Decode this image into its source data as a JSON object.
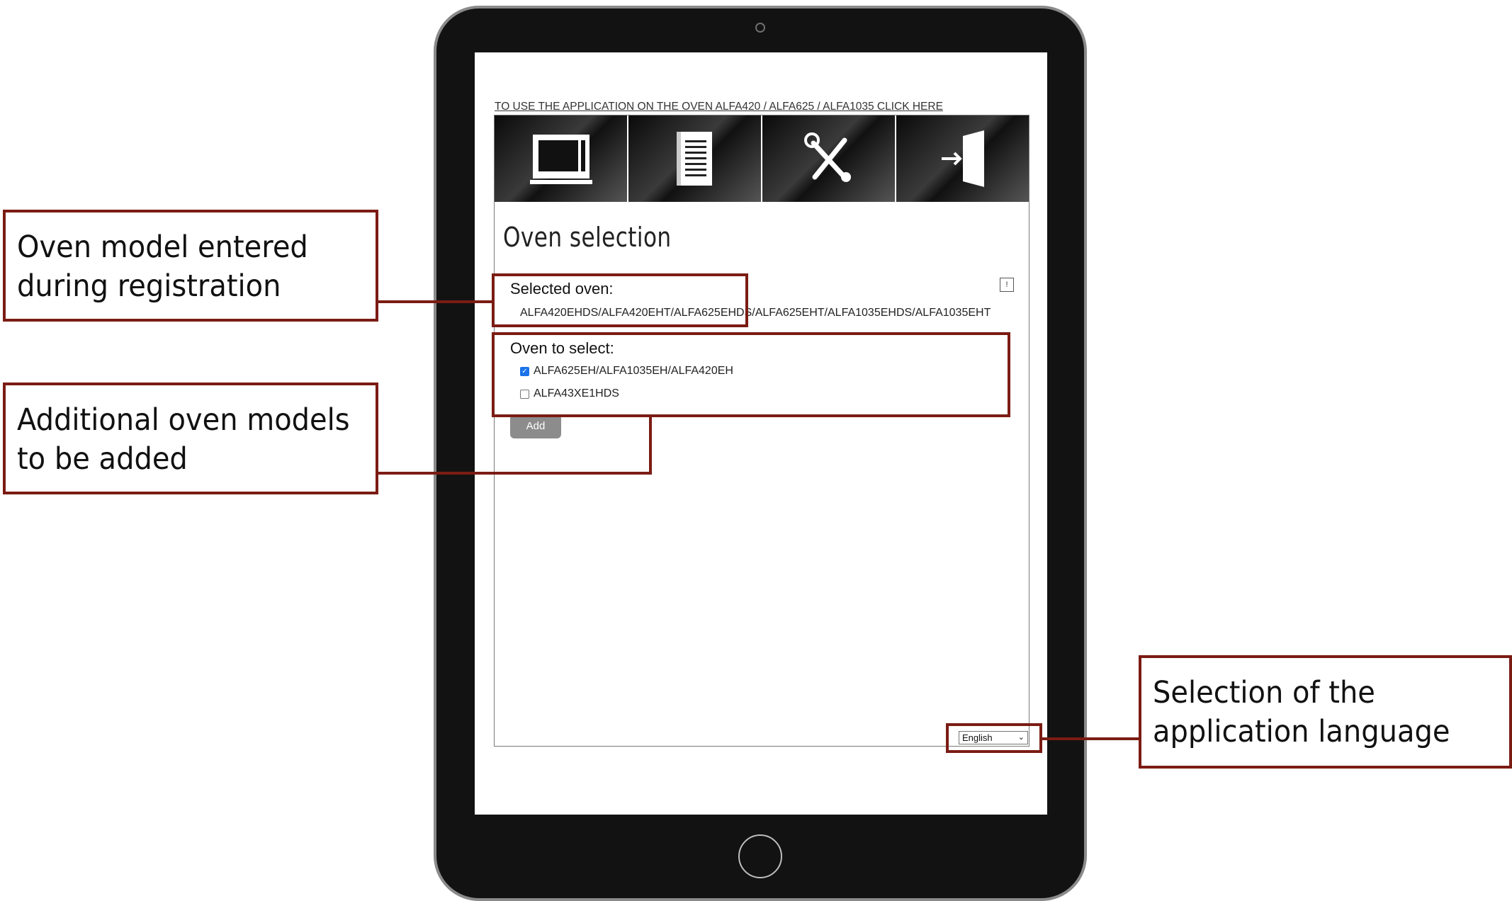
{
  "screen": {
    "use_link": "TO USE THE APPLICATION ON THE OVEN ALFA420 / ALFA625 / ALFA1035 CLICK HERE",
    "toolbar": {
      "icons": [
        "oven-icon",
        "manual-icon",
        "tools-icon",
        "logout-icon"
      ]
    },
    "page_title": "Oven selection",
    "selected_oven": {
      "label": "Selected oven:",
      "value": "ALFA420EHDS/ALFA420EHT/ALFA625EHDS/ALFA625EHT/ALFA1035EHDS/ALFA1035EHT"
    },
    "oven_to_select": {
      "label": "Oven to select:",
      "options": [
        {
          "label": "ALFA625EH/ALFA1035EH/ALFA420EH",
          "checked": true
        },
        {
          "label": "ALFA43XE1HDS",
          "checked": false
        }
      ]
    },
    "add_button": "Add",
    "language": "English"
  },
  "callouts": {
    "registration": [
      "Oven model entered",
      "during registration"
    ],
    "additional": [
      "Additional oven models",
      "to be added"
    ],
    "language": [
      "Selection of the",
      "application language"
    ]
  },
  "colors": {
    "callout_border": "#7b1c14",
    "tablet_body": "#121212",
    "checkbox_accent": "#1a73e8",
    "add_button": "#8c8c8c"
  }
}
